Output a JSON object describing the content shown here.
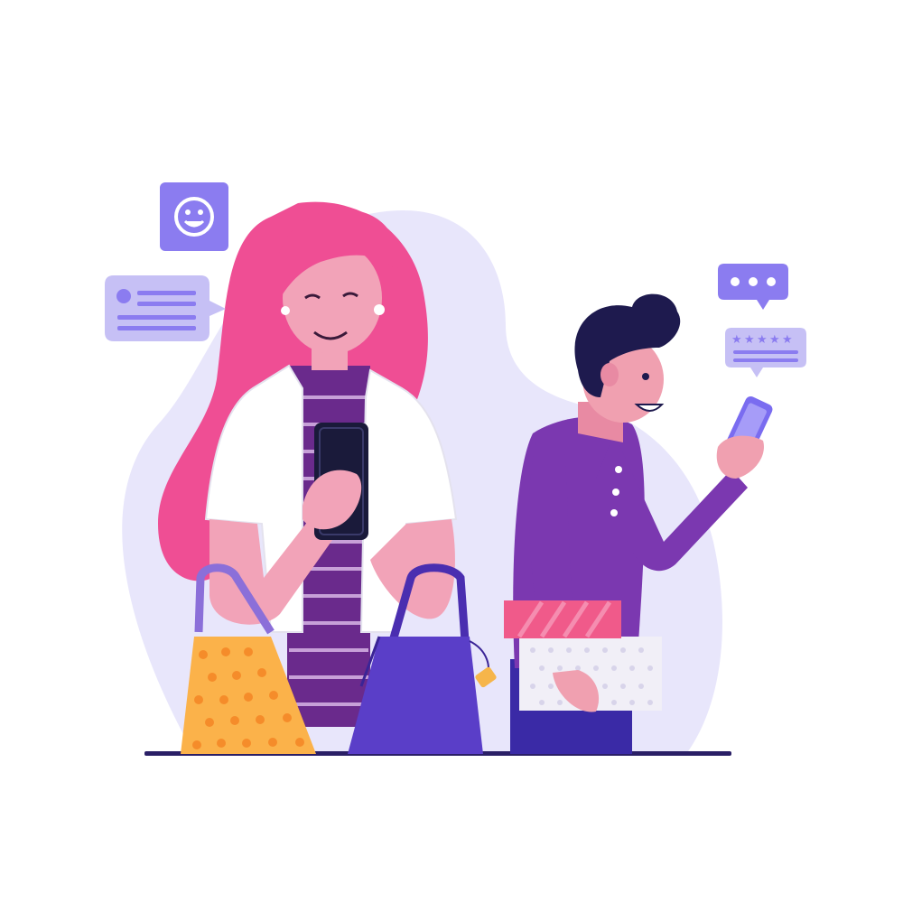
{
  "scene": {
    "kind": "flat vector illustration",
    "background": "#ffffff",
    "backdrop_color": "#e8e6fb",
    "ground_line_color": "#2a1f66"
  },
  "woman": {
    "hair_color": "#ef4e94",
    "skin_color": "#f2a3b8",
    "jacket_color": "#ffffff",
    "shirt_stripe_colors": [
      "#6a2a8c",
      "#c7a0d8"
    ],
    "phone_color": "#1a1a3a"
  },
  "man": {
    "hair_color": "#1e1a4e",
    "skin_color": "#f0a0b0",
    "shirt_color": "#7b38b0",
    "pants_color": "#3a2aa6",
    "phone_color": "#7a6cf0"
  },
  "bags": {
    "yellow_bag_color": "#fbb24a",
    "yellow_bag_dots": "#f58c2a",
    "purple_bag_color": "#5a3ec8",
    "price_tag_color": "#f6b54a"
  },
  "gift_boxes": {
    "top_box_color": "#f05a8a",
    "bottom_box_color": "#f1eff7"
  },
  "icons": {
    "smiley_tile_color": "#8b7cf0",
    "chat_bubble_color": "#c6c0f5",
    "dots_bubble_color": "#8b7cf0",
    "star_review_color": "#c6c0f5",
    "star_count": 5
  }
}
